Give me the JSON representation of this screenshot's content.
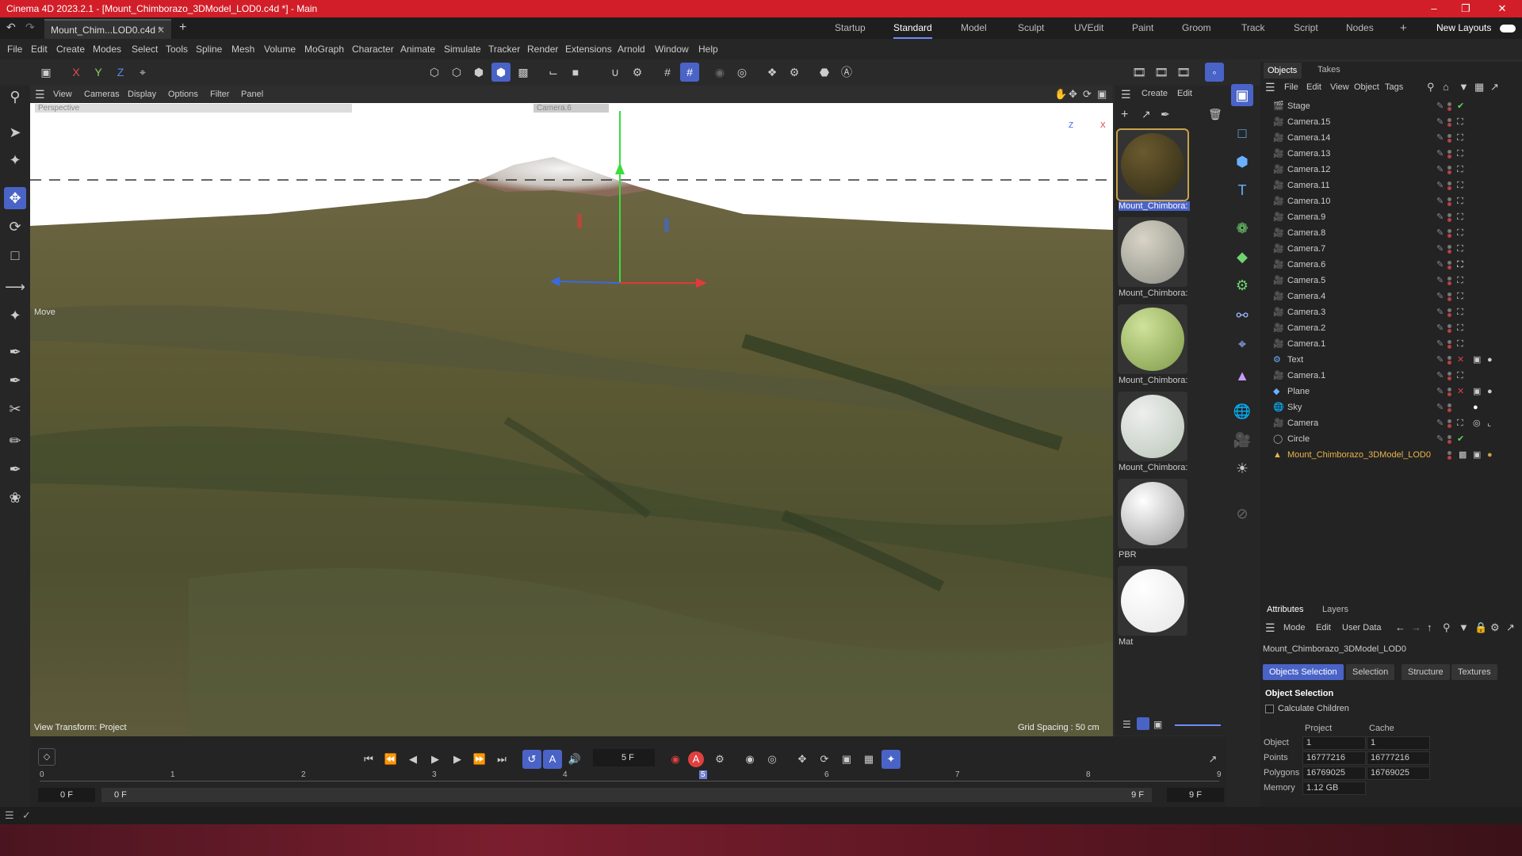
{
  "app": {
    "title": "Cinema 4D 2023.2.1 - [Mount_Chimborazo_3DModel_LOD0.c4d *] - Main",
    "doc_tab": "Mount_Chim...LOD0.c4d *",
    "new_layouts": "New Layouts"
  },
  "layouts": [
    "Startup",
    "Standard",
    "Model",
    "Sculpt",
    "UVEdit",
    "Paint",
    "Groom",
    "Track",
    "Script",
    "Nodes"
  ],
  "menus": [
    "File",
    "Edit",
    "Create",
    "Modes",
    "Select",
    "Tools",
    "Spline",
    "Mesh",
    "Volume",
    "MoGraph",
    "Character",
    "Animate",
    "Simulate",
    "Tracker",
    "Render",
    "Extensions",
    "Arnold",
    "Window",
    "Help"
  ],
  "axis_buttons": {
    "x": "X",
    "y": "Y",
    "z": "Z"
  },
  "viewport": {
    "menus": [
      "View",
      "Cameras",
      "Display",
      "Options",
      "Filter",
      "Panel"
    ],
    "label": "Perspective",
    "camera": "Camera.6",
    "tool_label": "Move",
    "view_transform": "View Transform: Project",
    "grid_spacing": "Grid Spacing : 50 cm",
    "axis_z": "Z",
    "axis_x": "X"
  },
  "materials": {
    "menus": [
      "Create",
      "Edit"
    ],
    "items": [
      {
        "name": "Mount_Chimbora:",
        "color_a": "#6b5a2e",
        "color_b": "#2d2a16",
        "selected": true
      },
      {
        "name": "Mount_Chimbora:",
        "color_a": "#d8d4c6",
        "color_b": "#8a8c84",
        "selected": false
      },
      {
        "name": "Mount_Chimbora:",
        "color_a": "#cfe29a",
        "color_b": "#7e9a48",
        "selected": false
      },
      {
        "name": "Mount_Chimbora:",
        "color_a": "#eeeeee",
        "color_b": "#b9c7b8",
        "selected": false
      },
      {
        "name": "PBR",
        "color_a": "#ffffff",
        "color_b": "#9a9a9a",
        "selected": false
      },
      {
        "name": "Mat",
        "color_a": "#ffffff",
        "color_b": "#e6e6e6",
        "selected": false
      }
    ]
  },
  "objects": {
    "tabs": [
      "Objects",
      "Takes"
    ],
    "menus": [
      "File",
      "Edit",
      "View",
      "Object",
      "Tags"
    ],
    "items": [
      "Stage",
      "Camera.15",
      "Camera.14",
      "Camera.13",
      "Camera.12",
      "Camera.11",
      "Camera.10",
      "Camera.9",
      "Camera.8",
      "Camera.7",
      "Camera.6",
      "Camera.5",
      "Camera.4",
      "Camera.3",
      "Camera.2",
      "Camera.1",
      "Text",
      "Camera.1",
      "Plane",
      "Sky",
      "Camera",
      "Circle",
      "Mount_Chimborazo_3DModel_LOD0"
    ],
    "selected_color": "#e8b54a"
  },
  "attributes": {
    "tabs": [
      "Attributes",
      "Layers"
    ],
    "menus": [
      "Mode",
      "Edit",
      "User Data"
    ],
    "object_name": "Mount_Chimborazo_3DModel_LOD0",
    "subtabs": [
      "Objects Selection",
      "Selection",
      "Structure",
      "Textures"
    ],
    "section": "Object Selection",
    "calc_children": "Calculate Children",
    "col_project": "Project",
    "col_cache": "Cache",
    "rows": [
      {
        "label": "Object",
        "project": "1",
        "cache": "1"
      },
      {
        "label": "Points",
        "project": "16777216",
        "cache": "16777216"
      },
      {
        "label": "Polygons",
        "project": "16769025",
        "cache": "16769025"
      },
      {
        "label": "Memory",
        "project": "1.12 GB",
        "cache": ""
      }
    ]
  },
  "timeline": {
    "current_frame": "5 F",
    "start": "0 F",
    "start2": "0 F",
    "end": "9 F",
    "end2": "9 F",
    "ticks": [
      "0",
      "1",
      "2",
      "3",
      "4",
      "5",
      "6",
      "7",
      "8",
      "9"
    ]
  },
  "colors": {
    "accent": "#4a63c7",
    "titlebar": "#d21e28"
  }
}
